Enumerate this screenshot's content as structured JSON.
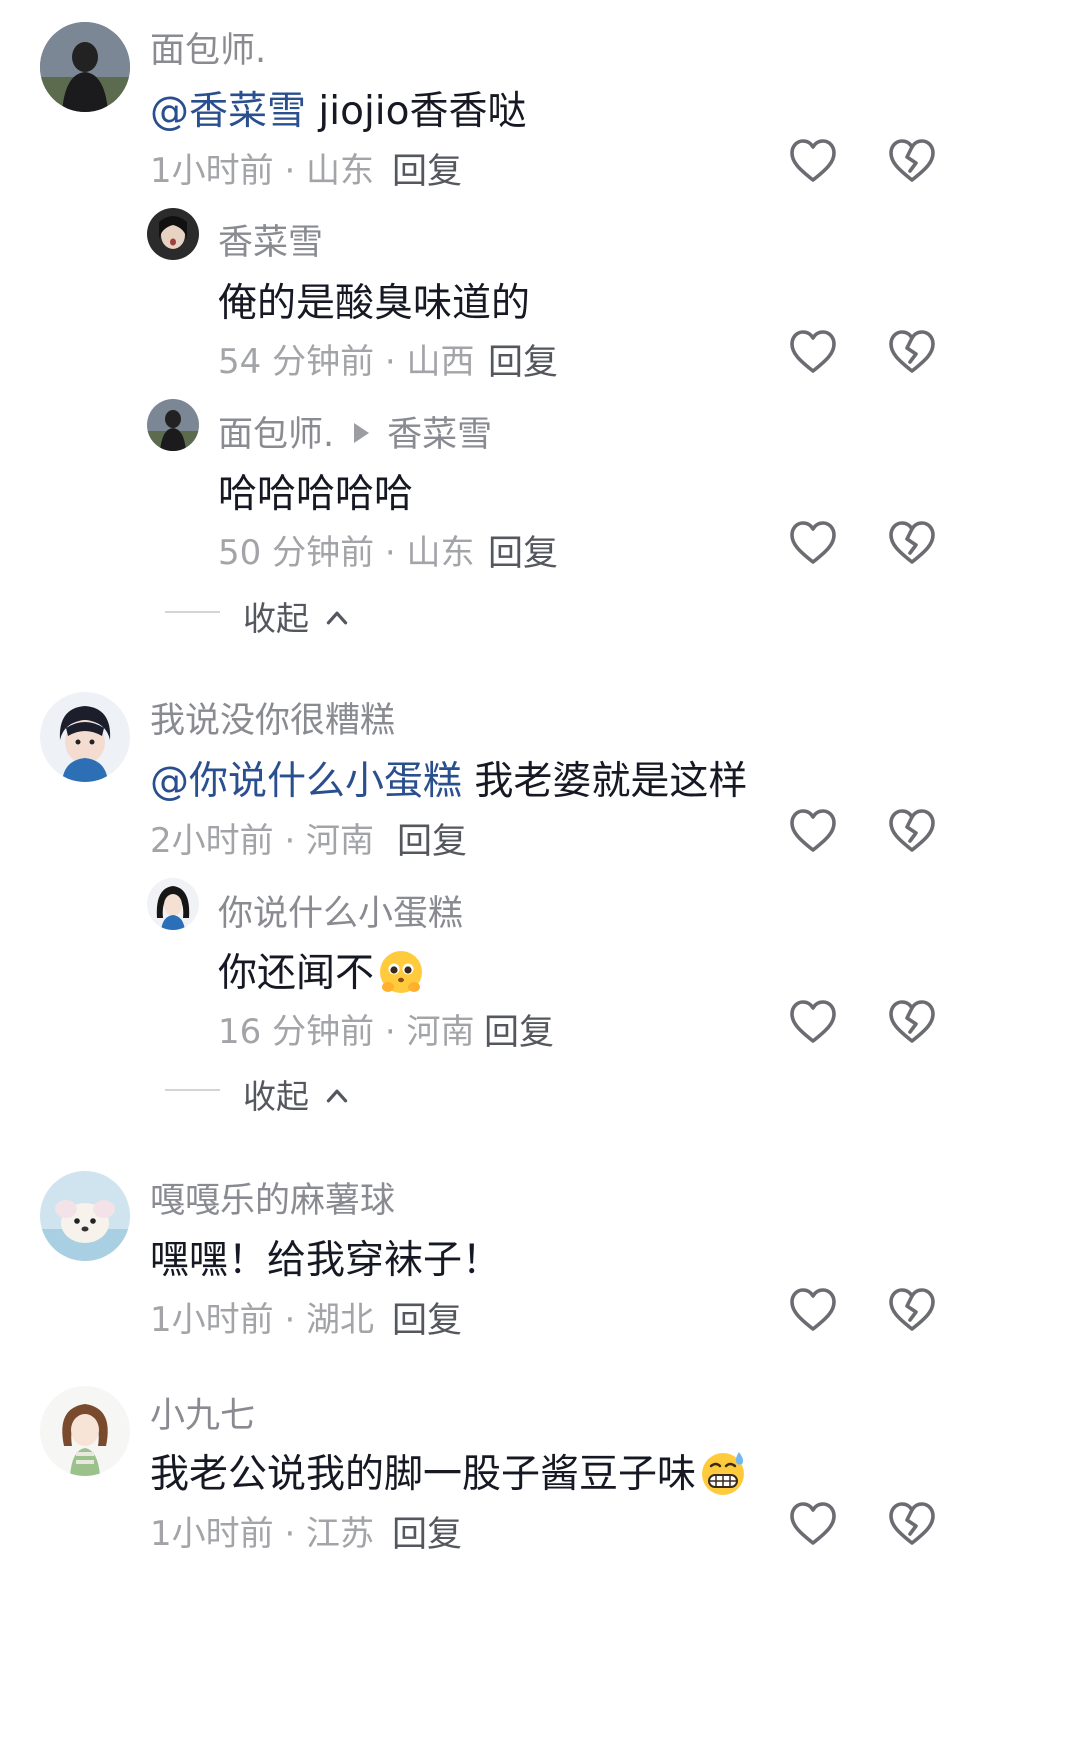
{
  "comments": [
    {
      "username": "面包师.",
      "mention": "@香菜雪",
      "text": " jiojio香香哒",
      "time_location": "1小时前 · 山东",
      "reply_label": "回复",
      "replies": [
        {
          "username": "香菜雪",
          "text": "俺的是酸臭味道的",
          "time_location": "54 分钟前 · 山西",
          "reply_label": "回复"
        },
        {
          "username": "面包师.",
          "reply_to": "香菜雪",
          "text": "哈哈哈哈哈",
          "time_location": "50 分钟前 · 山东",
          "reply_label": "回复"
        }
      ],
      "collapse_label": "收起"
    },
    {
      "username": "我说没你很糟糕",
      "mention": "@你说什么小蛋糕",
      "text": " 我老婆就是这样",
      "time_location": "2小时前 · 河南",
      "reply_label": "回复",
      "replies": [
        {
          "username": "你说什么小蛋糕",
          "text": "你还闻不",
          "emoji": "pleading-face-emoji",
          "time_location": "16 分钟前 · 河南",
          "reply_label": "回复"
        }
      ],
      "collapse_label": "收起"
    },
    {
      "username": "嘎嘎乐的麻薯球",
      "text": "嘿嘿！给我穿袜子！",
      "time_location": "1小时前 · 湖北",
      "reply_label": "回复"
    },
    {
      "username": "小九七",
      "text": "我老公说我的脚一股子酱豆子味",
      "emoji": "grimacing-sweat-emoji",
      "time_location": "1小时前 · 江苏",
      "reply_label": "回复"
    }
  ],
  "icons": {
    "like": "heart-outline-icon",
    "dislike": "broken-heart-outline-icon",
    "collapse": "chevron-up-icon"
  },
  "colors": {
    "mention": "#2a4f8f",
    "username": "#8a8b91",
    "meta": "#a3a4a8",
    "text": "#161823",
    "icon": "#6b6c72"
  }
}
